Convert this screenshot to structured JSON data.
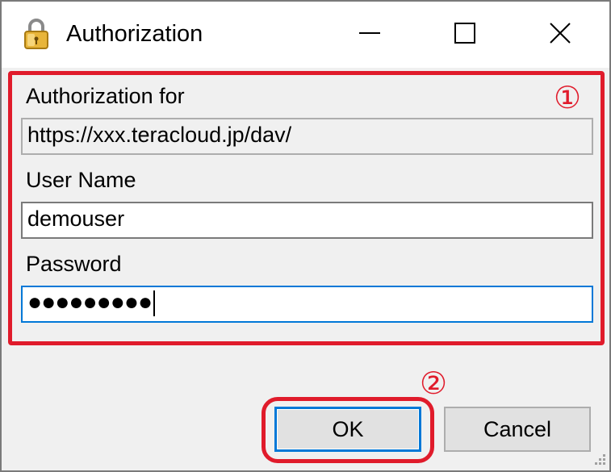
{
  "window": {
    "title": "Authorization",
    "icon": "padlock-icon"
  },
  "titlebar": {
    "minimize_icon": "minimize-icon",
    "maximize_icon": "maximize-icon",
    "close_icon": "close-icon"
  },
  "form": {
    "auth_for_label": "Authorization for",
    "auth_for_value": "https://xxx.teracloud.jp/dav/",
    "username_label": "User Name",
    "username_value": "demouser",
    "password_label": "Password",
    "password_masked": "●●●●●●●●●"
  },
  "buttons": {
    "ok_label": "OK",
    "cancel_label": "Cancel"
  },
  "annotations": {
    "marker_1": "①",
    "marker_2": "②",
    "color": "#e01b2b"
  }
}
